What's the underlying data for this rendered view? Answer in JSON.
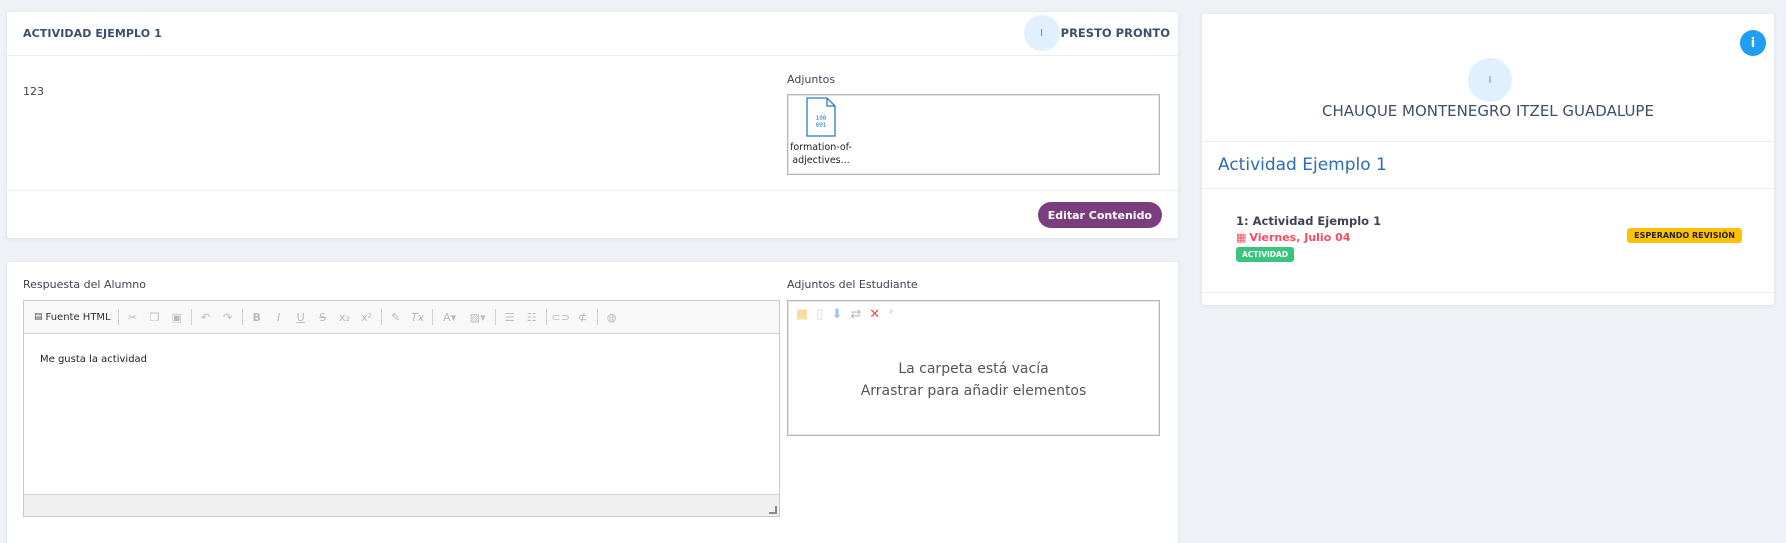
{
  "activity": {
    "title": "ACTIVIDAD EJEMPLO 1",
    "teacher_initial": "I",
    "teacher_name": "PRESTO PRONTO",
    "body": "123",
    "attachments_label": "Adjuntos",
    "file_name_line1": "formation-of-",
    "file_name_line2": "adjectives...",
    "file_icon_text": "100 001",
    "edit_button": "Editar Contenido"
  },
  "response": {
    "label": "Respuesta del Alumno",
    "source_button": "Fuente HTML",
    "content": "Me gusta la actividad",
    "student_attachments_label": "Adjuntos del Estudiante",
    "empty_line1": "La carpeta está vacía",
    "empty_line2": "Arrastrar para añadir elementos"
  },
  "side": {
    "student_initial": "I",
    "student_name": "CHAUQUE MONTENEGRO ITZEL GUADALUPE",
    "activity_title": "Actividad Ejemplo 1",
    "item_title": "1: Actividad Ejemplo 1",
    "item_date": "Viernes, Julio 04",
    "item_type": "ACTIVIDAD",
    "status": "ESPERANDO REVISIÓN",
    "info_icon": "i"
  },
  "colors": {
    "edit_button": "#7a3e7e",
    "accent_blue": "#2c6bb5",
    "date_red": "#f64e60",
    "status_yellow": "#ffc107",
    "type_green": "#3ac47d"
  }
}
